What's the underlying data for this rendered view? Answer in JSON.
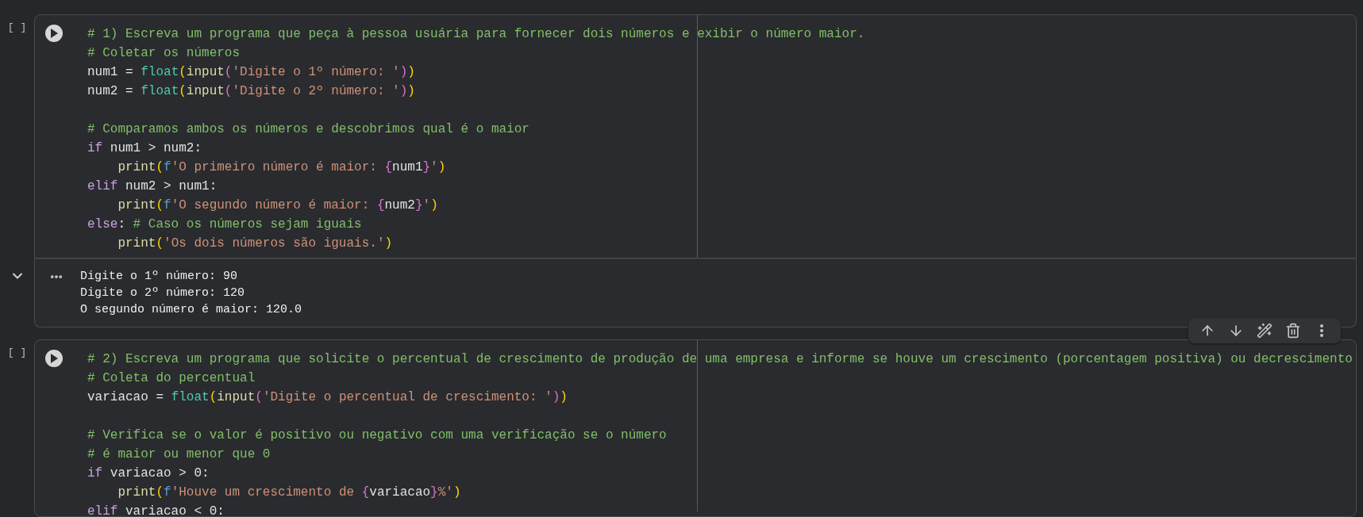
{
  "cells": [
    {
      "exec_label": "[ ]",
      "lines": [
        {
          "kind": "code",
          "tokens": [
            {
              "kind": "comment",
              "text": "# 1) Escreva um programa que peça à pessoa usuária para fornecer dois números e exibir o número maior."
            }
          ]
        },
        {
          "kind": "code",
          "tokens": [
            {
              "kind": "comment",
              "text": "# Coletar os números"
            }
          ]
        },
        {
          "kind": "code",
          "tokens": [
            {
              "kind": "plain",
              "text": "num1 = "
            },
            {
              "kind": "builtin",
              "text": "float"
            },
            {
              "kind": "paren1",
              "text": "("
            },
            {
              "kind": "func",
              "text": "input"
            },
            {
              "kind": "paren2",
              "text": "("
            },
            {
              "kind": "string",
              "text": "'Digite o 1º número: '"
            },
            {
              "kind": "paren2",
              "text": ")"
            },
            {
              "kind": "paren1",
              "text": ")"
            }
          ]
        },
        {
          "kind": "code",
          "tokens": [
            {
              "kind": "plain",
              "text": "num2 = "
            },
            {
              "kind": "builtin",
              "text": "float"
            },
            {
              "kind": "paren1",
              "text": "("
            },
            {
              "kind": "func",
              "text": "input"
            },
            {
              "kind": "paren2",
              "text": "("
            },
            {
              "kind": "string",
              "text": "'Digite o 2º número: '"
            },
            {
              "kind": "paren2",
              "text": ")"
            },
            {
              "kind": "paren1",
              "text": ")"
            }
          ]
        },
        {
          "kind": "blank"
        },
        {
          "kind": "code",
          "tokens": [
            {
              "kind": "comment",
              "text": "# Comparamos ambos os números e descobrimos qual é o maior"
            }
          ]
        },
        {
          "kind": "code",
          "tokens": [
            {
              "kind": "keyword",
              "text": "if"
            },
            {
              "kind": "plain",
              "text": " num1 > num2:"
            }
          ]
        },
        {
          "kind": "code",
          "indent": true,
          "tokens": [
            {
              "kind": "func",
              "text": "print"
            },
            {
              "kind": "paren1",
              "text": "("
            },
            {
              "kind": "prefix",
              "text": "f"
            },
            {
              "kind": "string",
              "text": "'O primeiro número é maior: "
            },
            {
              "kind": "brace",
              "text": "{"
            },
            {
              "kind": "plain",
              "text": "num1"
            },
            {
              "kind": "brace",
              "text": "}"
            },
            {
              "kind": "string",
              "text": "'"
            },
            {
              "kind": "paren1",
              "text": ")"
            }
          ]
        },
        {
          "kind": "code",
          "tokens": [
            {
              "kind": "keyword",
              "text": "elif"
            },
            {
              "kind": "plain",
              "text": " num2 > num1:"
            }
          ]
        },
        {
          "kind": "code",
          "indent": true,
          "tokens": [
            {
              "kind": "func",
              "text": "print"
            },
            {
              "kind": "paren1",
              "text": "("
            },
            {
              "kind": "prefix",
              "text": "f"
            },
            {
              "kind": "string",
              "text": "'O segundo número é maior: "
            },
            {
              "kind": "brace",
              "text": "{"
            },
            {
              "kind": "plain",
              "text": "num2"
            },
            {
              "kind": "brace",
              "text": "}"
            },
            {
              "kind": "string",
              "text": "'"
            },
            {
              "kind": "paren1",
              "text": ")"
            }
          ]
        },
        {
          "kind": "code",
          "tokens": [
            {
              "kind": "keyword",
              "text": "else"
            },
            {
              "kind": "plain",
              "text": ": "
            },
            {
              "kind": "comment",
              "text": "# Caso os números sejam iguais"
            }
          ]
        },
        {
          "kind": "code",
          "indent": true,
          "tokens": [
            {
              "kind": "func",
              "text": "print"
            },
            {
              "kind": "paren1",
              "text": "("
            },
            {
              "kind": "string",
              "text": "'Os dois números são iguais.'"
            },
            {
              "kind": "paren1",
              "text": ")"
            }
          ]
        }
      ],
      "output": [
        "Digite o 1º número: 90",
        "Digite o 2º número: 120",
        "O segundo número é maior: 120.0"
      ]
    },
    {
      "exec_label": "[ ]",
      "toolbar": true,
      "lines": [
        {
          "kind": "code",
          "tokens": [
            {
              "kind": "comment",
              "text": "# 2) Escreva um programa que solicite o percentual de crescimento de produção de uma empresa e informe se houve um crescimento (porcentagem positiva) ou decrescimento"
            }
          ]
        },
        {
          "kind": "code",
          "tokens": [
            {
              "kind": "comment",
              "text": "# Coleta do percentual"
            }
          ]
        },
        {
          "kind": "code",
          "tokens": [
            {
              "kind": "plain",
              "text": "variacao = "
            },
            {
              "kind": "builtin",
              "text": "float"
            },
            {
              "kind": "paren1",
              "text": "("
            },
            {
              "kind": "func",
              "text": "input"
            },
            {
              "kind": "paren2",
              "text": "("
            },
            {
              "kind": "string",
              "text": "'Digite o percentual de crescimento: '"
            },
            {
              "kind": "paren2",
              "text": ")"
            },
            {
              "kind": "paren1",
              "text": ")"
            }
          ]
        },
        {
          "kind": "blank"
        },
        {
          "kind": "code",
          "tokens": [
            {
              "kind": "comment",
              "text": "# Verifica se o valor é positivo ou negativo com uma verificação se o número"
            }
          ]
        },
        {
          "kind": "code",
          "tokens": [
            {
              "kind": "comment",
              "text": "# é maior ou menor que 0"
            }
          ]
        },
        {
          "kind": "code",
          "tokens": [
            {
              "kind": "keyword",
              "text": "if"
            },
            {
              "kind": "plain",
              "text": " variacao > 0:"
            }
          ]
        },
        {
          "kind": "code",
          "indent": true,
          "tokens": [
            {
              "kind": "func",
              "text": "print"
            },
            {
              "kind": "paren1",
              "text": "("
            },
            {
              "kind": "prefix",
              "text": "f"
            },
            {
              "kind": "string",
              "text": "'Houve um crescimento de "
            },
            {
              "kind": "brace",
              "text": "{"
            },
            {
              "kind": "plain",
              "text": "variacao"
            },
            {
              "kind": "brace",
              "text": "}"
            },
            {
              "kind": "string",
              "text": "%'"
            },
            {
              "kind": "paren1",
              "text": ")"
            }
          ]
        },
        {
          "kind": "code",
          "tokens": [
            {
              "kind": "keyword",
              "text": "elif"
            },
            {
              "kind": "plain",
              "text": " variacao < 0:"
            }
          ]
        }
      ]
    }
  ]
}
